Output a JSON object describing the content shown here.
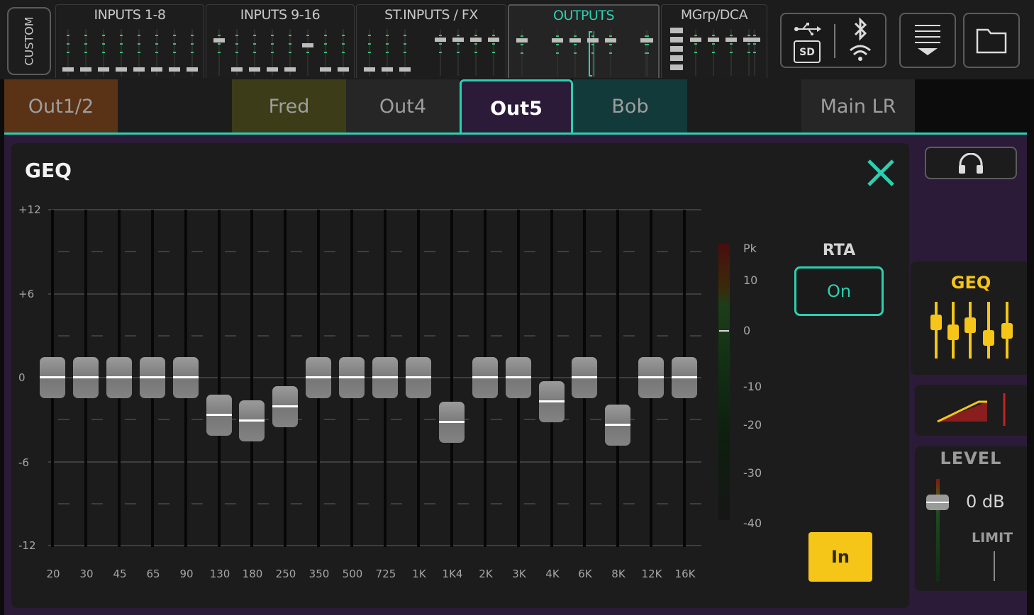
{
  "nav": {
    "custom_label": "CUSTOM",
    "sections": [
      {
        "label": "INPUTS 1-8",
        "active": false
      },
      {
        "label": "INPUTS 9-16",
        "active": false
      },
      {
        "label": "ST.INPUTS / FX",
        "active": false
      },
      {
        "label": "OUTPUTS",
        "active": true
      },
      {
        "label": "MGrp/DCA",
        "active": false
      }
    ]
  },
  "tabs": [
    {
      "label": "Out1/2",
      "color": "#5a3216"
    },
    {
      "label": "",
      "color": "#1c1c1c"
    },
    {
      "label": "Fred",
      "color": "#3c3c18"
    },
    {
      "label": "Out4",
      "color": "#262626"
    },
    {
      "label": "Out5",
      "color": "#2b1b38",
      "active": true
    },
    {
      "label": "Bob",
      "color": "#123a3a"
    },
    {
      "label": "",
      "color": "#1c1c1c"
    },
    {
      "label": "Main LR",
      "color": "#262626"
    }
  ],
  "geq": {
    "title": "GEQ",
    "scale_labels": [
      "+12",
      "+6",
      "0",
      "-6",
      "-12"
    ],
    "bands": [
      {
        "freq": "20",
        "gain_db": 0
      },
      {
        "freq": "30",
        "gain_db": 0
      },
      {
        "freq": "45",
        "gain_db": 0
      },
      {
        "freq": "65",
        "gain_db": 0
      },
      {
        "freq": "90",
        "gain_db": 0
      },
      {
        "freq": "130",
        "gain_db": -2.7
      },
      {
        "freq": "180",
        "gain_db": -3.1
      },
      {
        "freq": "250",
        "gain_db": -2.1
      },
      {
        "freq": "350",
        "gain_db": 0
      },
      {
        "freq": "500",
        "gain_db": 0
      },
      {
        "freq": "725",
        "gain_db": 0
      },
      {
        "freq": "1K",
        "gain_db": 0
      },
      {
        "freq": "1K4",
        "gain_db": -3.2
      },
      {
        "freq": "2K",
        "gain_db": 0
      },
      {
        "freq": "3K",
        "gain_db": 0
      },
      {
        "freq": "4K",
        "gain_db": -1.7
      },
      {
        "freq": "6K",
        "gain_db": 0
      },
      {
        "freq": "8K",
        "gain_db": -3.4
      },
      {
        "freq": "12K",
        "gain_db": 0
      },
      {
        "freq": "16K",
        "gain_db": 0
      }
    ],
    "meter_labels": [
      "Pk",
      "10",
      "0",
      "-10",
      "-20",
      "-30",
      "-40"
    ],
    "rta_label": "RTA",
    "rta_button": "On",
    "in_button": "In"
  },
  "sidebar": {
    "geq_label": "GEQ",
    "level_label": "LEVEL",
    "level_value": "0 dB",
    "limit_label": "LIMIT"
  },
  "colors": {
    "accent": "#2bd0b0",
    "yellow": "#f5c518",
    "panel_purple": "#2b1b38"
  }
}
